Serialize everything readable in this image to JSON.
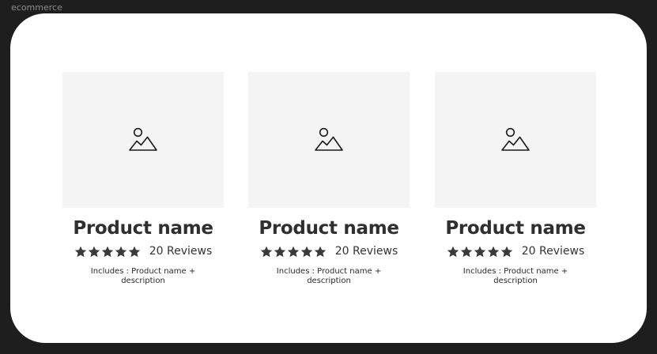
{
  "window": {
    "frame_label": "ecommerce"
  },
  "products": [
    {
      "name": "Product name",
      "rating": 5,
      "reviews_text": "20 Reviews",
      "description": "Includes : Product name + description",
      "image_icon": "image-placeholder-icon"
    },
    {
      "name": "Product name",
      "rating": 5,
      "reviews_text": "20 Reviews",
      "description": "Includes : Product name + description",
      "image_icon": "image-placeholder-icon"
    },
    {
      "name": "Product name",
      "rating": 5,
      "reviews_text": "20 Reviews",
      "description": "Includes : Product name + description",
      "image_icon": "image-placeholder-icon"
    }
  ],
  "colors": {
    "page_background": "#1e1e1e",
    "frame_background": "#ffffff",
    "image_placeholder": "#f4f4f4",
    "star": "#3a3a3a",
    "text": "#2f2f2f"
  }
}
